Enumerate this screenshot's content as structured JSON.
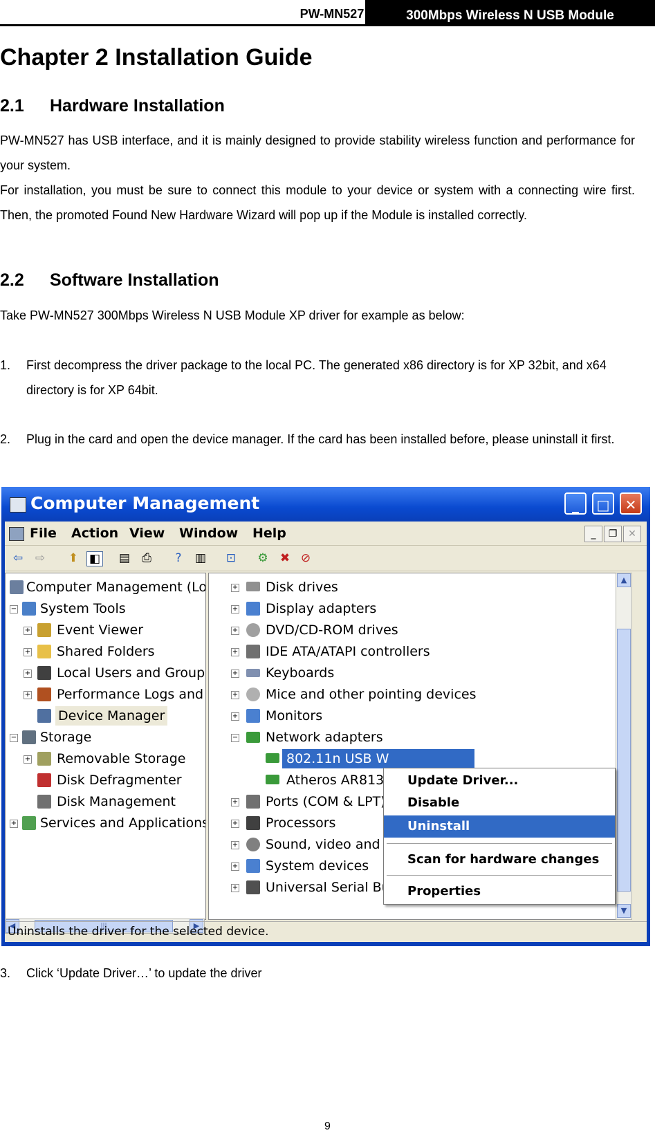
{
  "header": {
    "model": "PW-MN527",
    "product": "300Mbps Wireless N USB Module"
  },
  "chapter_title": "Chapter 2  Installation Guide",
  "sections": [
    {
      "number": "2.1",
      "title": "Hardware Installation"
    },
    {
      "number": "2.2",
      "title": "Software Installation"
    }
  ],
  "hw_para1": "PW-MN527 has USB interface, and it is mainly designed to provide stability wireless function and performance for your system.",
  "hw_para2": "For installation, you must be sure to connect this module to your device or system with a connecting wire first. Then, the promoted Found New Hardware Wizard will pop up if the Module is installed correctly.",
  "sw_intro": "Take PW-MN527 300Mbps Wireless N USB Module XP driver for example as below:",
  "steps": [
    {
      "num": "1.",
      "text": "First decompress the driver package to the local PC. The generated x86 directory is for XP 32bit, and x64 directory is for XP 64bit."
    },
    {
      "num": "2.",
      "text": "Plug in the card and open the device manager. If the card has been installed before, please uninstall it first."
    },
    {
      "num": "3.",
      "text": "Click ‘Update Driver…’ to update the driver"
    }
  ],
  "page_number": "9",
  "screenshot": {
    "title": "Computer Management",
    "menu": [
      "File",
      "Action",
      "View",
      "Window",
      "Help"
    ],
    "left_tree": [
      {
        "label": "Computer Management (Local",
        "icon": "computer-icon",
        "color": "#6b7f9e"
      },
      {
        "label": "System Tools",
        "icon": "tools-icon",
        "color": "#4a7fc8"
      },
      {
        "label": "Event Viewer",
        "icon": "event-viewer-icon",
        "color": "#c8a030"
      },
      {
        "label": "Shared Folders",
        "icon": "folder-icon",
        "color": "#e8c048"
      },
      {
        "label": "Local Users and Groups",
        "icon": "users-icon",
        "color": "#404040"
      },
      {
        "label": "Performance Logs and A",
        "icon": "performance-icon",
        "color": "#b05020"
      },
      {
        "label": "Device Manager",
        "icon": "device-manager-icon",
        "color": "#5070a0"
      },
      {
        "label": "Storage",
        "icon": "storage-icon",
        "color": "#607080"
      },
      {
        "label": "Removable Storage",
        "icon": "removable-storage-icon",
        "color": "#a0a060"
      },
      {
        "label": "Disk Defragmenter",
        "icon": "defrag-icon",
        "color": "#c03030"
      },
      {
        "label": "Disk Management",
        "icon": "disk-management-icon",
        "color": "#707070"
      },
      {
        "label": "Services and Applications",
        "icon": "services-icon",
        "color": "#50a050"
      }
    ],
    "right_tree": [
      {
        "label": "Disk drives",
        "icon": "disk-drive-icon",
        "color": "#909090"
      },
      {
        "label": "Display adapters",
        "icon": "display-icon",
        "color": "#4a80d0"
      },
      {
        "label": "DVD/CD-ROM drives",
        "icon": "dvd-icon",
        "color": "#a0a0a0"
      },
      {
        "label": "IDE ATA/ATAPI controllers",
        "icon": "ide-icon",
        "color": "#707070"
      },
      {
        "label": "Keyboards",
        "icon": "keyboard-icon",
        "color": "#8090b0"
      },
      {
        "label": "Mice and other pointing devices",
        "icon": "mouse-icon",
        "color": "#b0b0b0"
      },
      {
        "label": "Monitors",
        "icon": "monitor-icon",
        "color": "#4a80d0"
      },
      {
        "label": "Network adapters",
        "icon": "network-adapter-icon",
        "color": "#3a9a3a"
      },
      {
        "label": "802.11n USB W",
        "icon": "network-card-icon",
        "color": "#3a9a3a"
      },
      {
        "label": "Atheros AR813",
        "icon": "network-card-icon",
        "color": "#3a9a3a"
      },
      {
        "label": "Ports (COM & LPT)",
        "icon": "port-icon",
        "color": "#707070"
      },
      {
        "label": "Processors",
        "icon": "processor-icon",
        "color": "#404040"
      },
      {
        "label": "Sound, video and g",
        "icon": "sound-icon",
        "color": "#808080"
      },
      {
        "label": "System devices",
        "icon": "system-device-icon",
        "color": "#4a80d0"
      },
      {
        "label": "Universal Serial Bus controllers",
        "icon": "usb-icon",
        "color": "#505050"
      }
    ],
    "context_menu": [
      "Update Driver...",
      "Disable",
      "Uninstall",
      "Scan for hardware changes",
      "Properties"
    ],
    "status": "Uninstalls the driver for the selected device.",
    "selection_color": "#316ac5"
  }
}
